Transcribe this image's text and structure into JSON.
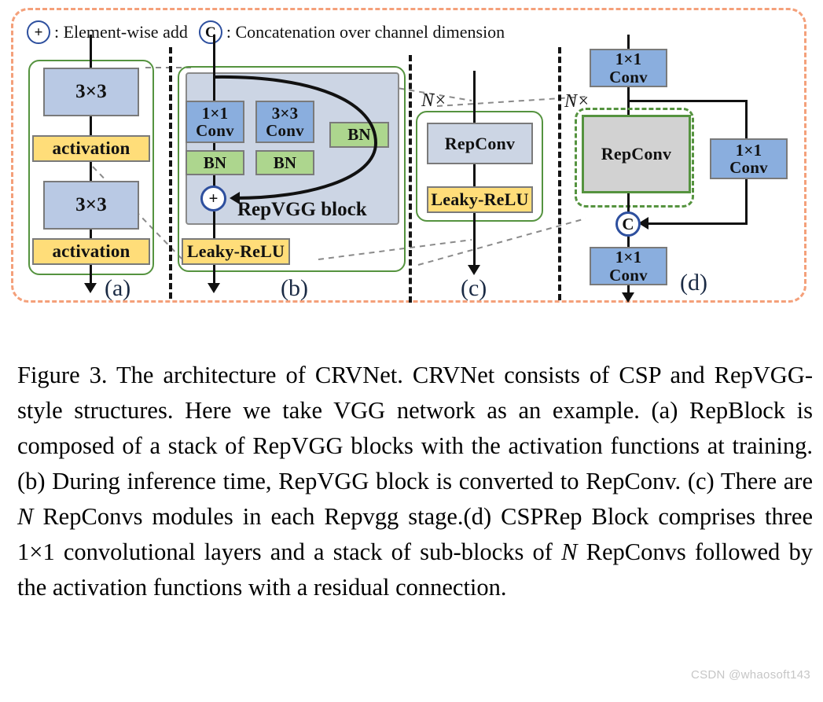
{
  "legend": {
    "add_symbol": "+",
    "add_text": ": Element-wise add",
    "concat_symbol": "C",
    "concat_text": ": Concatenation over channel dimension"
  },
  "panels": {
    "a": {
      "label": "(a)",
      "blocks": [
        {
          "text": "3×3",
          "color": "#b9c9e4"
        },
        {
          "text": "activation",
          "color": "#ffdd79"
        },
        {
          "text": "3×3",
          "color": "#b9c9e4"
        },
        {
          "text": "activation",
          "color": "#ffdd79"
        }
      ]
    },
    "b": {
      "label": "(b)",
      "title": "RepVGG block",
      "blocks": [
        {
          "text": "1×1\nConv",
          "color": "#8aaede"
        },
        {
          "text": "3×3\nConv",
          "color": "#8aaede"
        },
        {
          "text": "BN",
          "color": "#add68e"
        },
        {
          "text": "BN",
          "color": "#add68e"
        },
        {
          "text": "BN",
          "color": "#add68e"
        },
        {
          "text": "Leaky-ReLU",
          "color": "#ffdd79"
        }
      ],
      "conv_1x1_line1": "1×1",
      "conv_1x1_line2": "Conv",
      "conv_3x3_line1": "3×3",
      "conv_3x3_line2": "Conv",
      "bn": "BN",
      "leaky_relu": "Leaky-ReLU",
      "add_node": "+"
    },
    "c": {
      "label": "(c)",
      "repeat": "N×",
      "repconv": "RepConv",
      "leaky_relu": "Leaky-ReLU"
    },
    "d": {
      "label": "(d)",
      "repeat": "N×",
      "repconv": "RepConv",
      "conv_top_line1": "1×1",
      "conv_top_line2": "Conv",
      "conv_right_line1": "1×1",
      "conv_right_line2": "Conv",
      "conv_bottom_line1": "1×1",
      "conv_bottom_line2": "Conv",
      "concat_node": "C"
    }
  },
  "caption": {
    "full": "Figure 3. The architecture of CRVNet. CRVNet consists of CSP and RepVGG-style structures. Here we take VGG network as an example. (a) RepBlock is composed of a stack of RepVGG blocks with the activation functions at training. (b) During inference time, RepVGG block is converted to RepConv. (c) There are N RepConvs modules in each Repvgg stage.(d) CSPRep Block comprises three 1×1 convolutional layers and a stack of sub-blocks of N RepConvs followed by the activation functions with a residual connection.",
    "part1": "Figure 3. The architecture of CRVNet. CRVNet consists of CSP and RepVGG-style structures. Here we take VGG network as an example. (a) RepBlock is composed of a stack of RepVGG blocks with the activation functions at training. (b) During inference time, RepVGG block is converted to RepConv. (c) There are ",
    "italic1": "N",
    "part2": " RepConvs modules in each Repvgg stage.(d) CSPRep Block comprises three 1×1 convolutional layers and a stack of sub-blocks of ",
    "italic2": "N",
    "part3": " RepConvs followed by the activation functions with a residual connection."
  },
  "watermark": "CSDN @whaosoft143",
  "colors": {
    "outer_border": "#f4a07a",
    "green_outline": "#55933f",
    "blue_circle": "#2d4f9e",
    "conv_blue": "#8aaede",
    "light_blue": "#b9c9e4",
    "bn_green": "#add68e",
    "activation_yellow": "#ffdd79",
    "repconv_gray": "#d2d2d2",
    "repvgg_bg": "#ccd5e4"
  }
}
